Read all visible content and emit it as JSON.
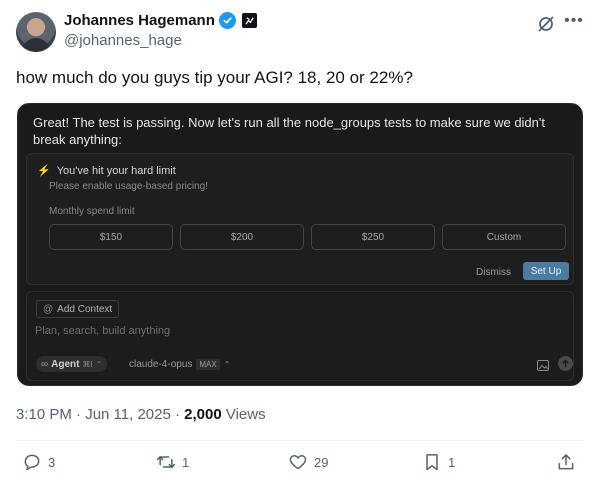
{
  "author": {
    "name": "Johannes Hagemann",
    "handle": "@johannes_hage"
  },
  "tweet": {
    "text": "how much do you guys tip your AGI? 18, 20 or 22%?"
  },
  "screenshot": {
    "message": "Great! The test is passing. Now let's run all the node_groups tests to make sure we didn't break anything:",
    "limit_title": "You've hit your hard limit",
    "limit_subtitle": "Please enable usage-based pricing!",
    "spend_label": "Monthly spend limit",
    "options": [
      "$150",
      "$200",
      "$250",
      "Custom"
    ],
    "dismiss_label": "Dismiss",
    "setup_label": "Set Up",
    "add_context_label": "Add Context",
    "placeholder": "Plan, search, build anything",
    "agent_label": "Agent",
    "agent_shortcut": "⌘I",
    "model_label": "claude-4-opus",
    "max_badge": "MAX"
  },
  "meta": {
    "time_date": "3:10 PM · Jun 11, 2025 · ",
    "views_count": "2,000",
    "views_label": " Views"
  },
  "actions": {
    "replies": "3",
    "reposts": "1",
    "likes": "29",
    "bookmarks": "1"
  },
  "colors": {
    "verified": "#1d9bf0",
    "muted_text": "#536471",
    "setup_button": "#4a7ba0"
  },
  "icons": [
    "verified-badge-icon",
    "affiliate-badge-icon",
    "grok-icon",
    "more-icon",
    "lightning-icon",
    "at-icon",
    "infinity-icon",
    "image-icon",
    "send-arrow-icon",
    "reply-icon",
    "repost-icon",
    "like-icon",
    "bookmark-icon",
    "share-icon"
  ]
}
